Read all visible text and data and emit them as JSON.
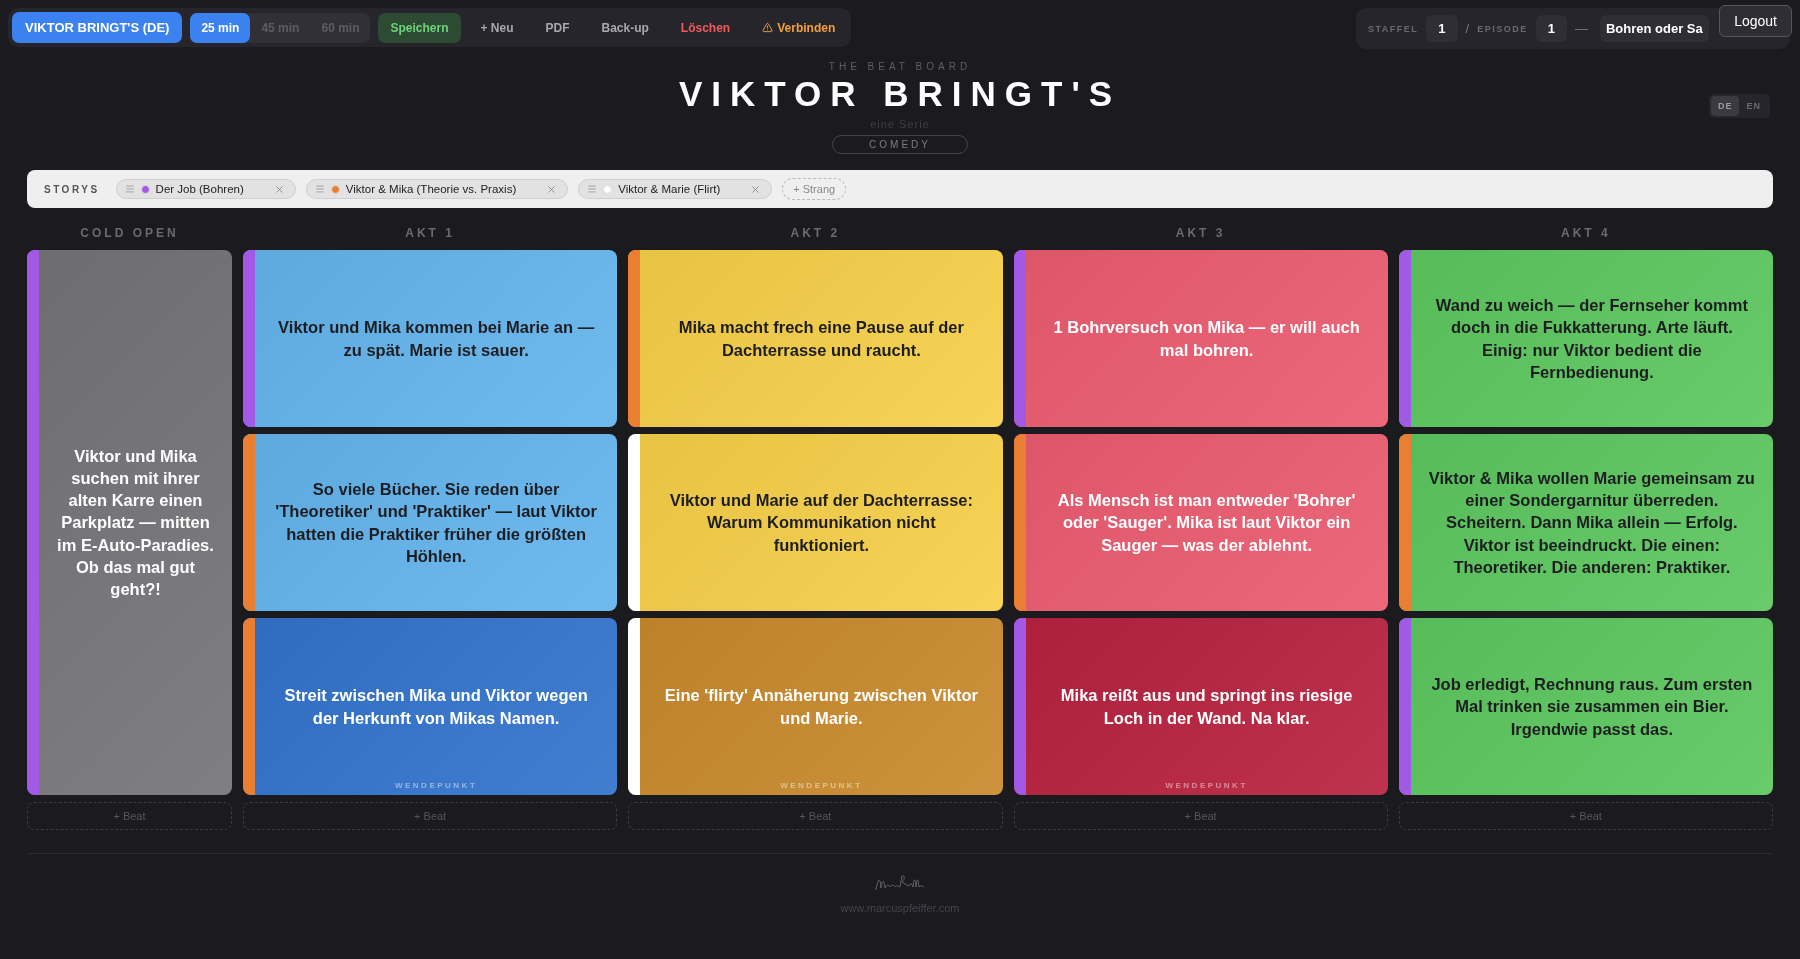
{
  "toolbar": {
    "project": "VIKTOR BRINGT'S (DE)",
    "durations": [
      {
        "label": "25 min",
        "selected": true
      },
      {
        "label": "45 min",
        "selected": false
      },
      {
        "label": "60 min",
        "selected": false
      }
    ],
    "buttons": [
      {
        "label": "Speichern",
        "kind": "save"
      },
      {
        "label": "+ Neu",
        "kind": "plain"
      },
      {
        "label": "PDF",
        "kind": "plain"
      },
      {
        "label": "Back-up",
        "kind": "plain"
      },
      {
        "label": "Löschen",
        "kind": "danger"
      },
      {
        "label": "Verbinden",
        "kind": "warning"
      }
    ]
  },
  "episode_bar": {
    "season_label": "STAFFEL",
    "season": "1",
    "separator": "/",
    "episode_label": "EPISODE",
    "episode": "1",
    "dash": "—",
    "title": "Bohren oder Sa"
  },
  "logout": "Logout",
  "languages": [
    {
      "label": "DE",
      "selected": true
    },
    {
      "label": "EN",
      "selected": false
    }
  ],
  "header": {
    "kicker": "THE BEAT BOARD",
    "title": "VIKTOR BRINGT'S",
    "subtitle": "eine Serie",
    "genre": "COMEDY"
  },
  "storys": {
    "label": "STORYS",
    "add": "+ Strang",
    "items": [
      {
        "name": "Der Job (Bohren)",
        "color": "#a259e6"
      },
      {
        "name": "Viktor & Mika (Theorie vs. Praxis)",
        "color": "#ea7f34"
      },
      {
        "name": "Viktor & Marie (Flirt)",
        "color": "#ffffff"
      }
    ]
  },
  "columns": [
    {
      "title": "COLD OPEN",
      "add": "+ Beat",
      "cards": [
        {
          "text": "Viktor und Mika suchen mit ihrer alten Karre einen Parkplatz — mitten im E-Auto-Paradies. Ob das mal gut geht?!",
          "color": "#747377",
          "stripe": {
            "color": "#a259e6"
          }
        }
      ]
    },
    {
      "title": "AKT 1",
      "add": "+ Beat",
      "cards": [
        {
          "text": "Viktor und Mika kommen bei Marie an — zu spät. Marie ist sauer.",
          "color": "#63b4ec",
          "stripe": {
            "color": "#a259e6"
          }
        },
        {
          "text": "So viele Bücher. Sie reden über 'Theoretiker' und 'Praktiker' — laut Viktor hatten die Praktiker früher die größten Höhlen.",
          "color": "#63b4ec",
          "stripe": {
            "color": "#ea7f34"
          }
        },
        {
          "text": "Streit zwischen Mika und Viktor wegen der Herkunft von Mikas Namen.",
          "color": "#3273cc",
          "stripe": {
            "color": "#ea7f34"
          },
          "marker": "WENDEPUNKT"
        }
      ]
    },
    {
      "title": "AKT 2",
      "add": "+ Beat",
      "cards": [
        {
          "text": "Mika macht frech eine Pause auf der Dachterrasse und raucht.",
          "color": "#f6cf48",
          "stripe": {
            "color": "#ea7f34"
          }
        },
        {
          "text": "Viktor und Marie auf der Dachterrasse: Warum Kommunikation nicht funktioniert.",
          "color": "#f6cf48",
          "stripe": {
            "color": "#ffffff"
          }
        },
        {
          "text": "Eine 'flirty' Annäherung zwischen Viktor und Marie.",
          "color": "#c8892c",
          "stripe": {
            "color": "#ffffff"
          },
          "marker": "WENDEPUNKT"
        }
      ]
    },
    {
      "title": "AKT 3",
      "add": "+ Beat",
      "cards": [
        {
          "text": "1 Bohrversuch von Mika — er will auch mal bohren.",
          "color": "#eb5b6f",
          "stripe": {
            "color": "#a259e6"
          }
        },
        {
          "text": "Als Mensch ist man entweder 'Bohrer' oder 'Sauger'. Mika ist laut Viktor ein Sauger — was der ablehnt.",
          "color": "#eb5b6f",
          "stripe": {
            "color": "#ea7f34"
          }
        },
        {
          "text": "Mika reißt aus und springt ins riesige Loch in der Wand. Na klar.",
          "color": "#b8213f",
          "stripe": {
            "color": "#a259e6"
          },
          "marker": "WENDEPUNKT"
        }
      ]
    },
    {
      "title": "AKT 4",
      "add": "+ Beat",
      "cards": [
        {
          "text": "Wand zu weich — der Fernseher kommt doch in die Fukkatterung. Arte läuft. Einig: nur Viktor bedient die Fernbedienung.",
          "color": "#5cc75f",
          "stripe": {
            "color": "#a259e6"
          }
        },
        {
          "text": "Viktor & Mika wollen Marie gemeinsam zu einer Sondergarnitur überreden. Scheitern. Dann Mika allein — Erfolg. Viktor ist beeindruckt. Die einen: Theoretiker. Die anderen: Praktiker.",
          "color": "#5cc75f",
          "stripe": {
            "color": "#ea7f34"
          }
        },
        {
          "text": "Job erledigt, Rechnung raus. Zum ersten Mal trinken sie zusammen ein Bier. Irgendwie passt das.",
          "color": "#5cc75f",
          "stripe": {
            "color": "#a259e6"
          }
        }
      ]
    }
  ],
  "footer": {
    "url": "www.marcuspfeiffer.com"
  }
}
